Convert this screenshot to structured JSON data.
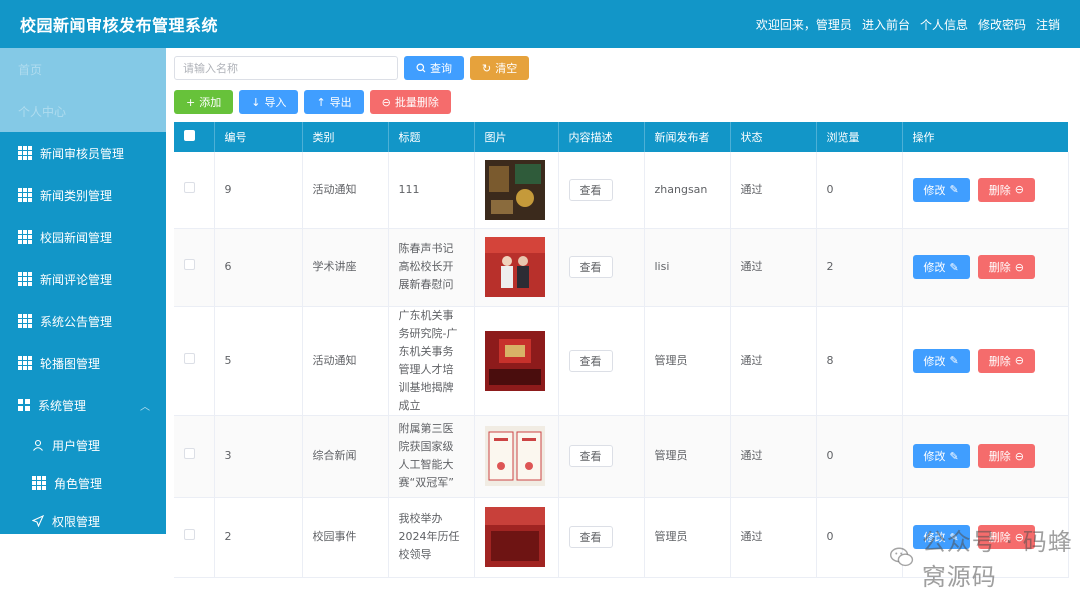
{
  "header": {
    "title": "校园新闻审核发布管理系统",
    "welcome": "欢迎回来，管理员",
    "links": [
      "进入前台",
      "个人信息",
      "修改密码",
      "注销"
    ]
  },
  "sidebar": {
    "faded_items": [
      "首页",
      "个人中心"
    ],
    "items": [
      {
        "label": "新闻审核员管理",
        "icon": "grid-icon"
      },
      {
        "label": "新闻类别管理",
        "icon": "grid-icon"
      },
      {
        "label": "校园新闻管理",
        "icon": "grid-icon"
      },
      {
        "label": "新闻评论管理",
        "icon": "grid-icon"
      },
      {
        "label": "系统公告管理",
        "icon": "grid-icon"
      },
      {
        "label": "轮播图管理",
        "icon": "grid-icon"
      },
      {
        "label": "系统管理",
        "icon": "grid4-icon"
      }
    ],
    "sub_items": [
      {
        "label": "用户管理",
        "icon": "user-icon"
      },
      {
        "label": "角色管理",
        "icon": "grid-icon"
      },
      {
        "label": "权限管理",
        "icon": "send-icon"
      }
    ]
  },
  "search": {
    "placeholder": "请输入名称",
    "query_label": "查询",
    "clear_label": "清空"
  },
  "toolbar": {
    "add_label": "添加",
    "import_label": "导入",
    "export_label": "导出",
    "batch_delete_label": "批量删除"
  },
  "table": {
    "headers": [
      "编号",
      "类别",
      "标题",
      "图片",
      "内容描述",
      "新闻发布者",
      "状态",
      "浏览量",
      "操作"
    ],
    "view_label": "查看",
    "edit_label": "修改",
    "delete_label": "删除",
    "rows": [
      {
        "id": "9",
        "category": "活动通知",
        "title": "111",
        "publisher": "zhangsan",
        "status": "通过",
        "views": "0"
      },
      {
        "id": "6",
        "category": "学术讲座",
        "title": "陈春声书记高松校长开展新春慰问",
        "publisher": "lisi",
        "status": "通过",
        "views": "2"
      },
      {
        "id": "5",
        "category": "活动通知",
        "title": "广东机关事务研究院-广东机关事务管理人才培训基地揭牌成立",
        "publisher": "管理员",
        "status": "通过",
        "views": "8"
      },
      {
        "id": "3",
        "category": "综合新闻",
        "title": "附属第三医院获国家级人工智能大赛“双冠军”",
        "publisher": "管理员",
        "status": "通过",
        "views": "0"
      },
      {
        "id": "2",
        "category": "校园事件",
        "title": "我校举办2024年历任校领导",
        "publisher": "管理员",
        "status": "通过",
        "views": "0"
      }
    ]
  },
  "watermark": {
    "text": "公众号 · 码蜂窝源码"
  },
  "colors": {
    "primary": "#1296c8",
    "blue": "#409eff",
    "orange": "#e6a23c",
    "green": "#67c23a",
    "red": "#f56c6c"
  }
}
